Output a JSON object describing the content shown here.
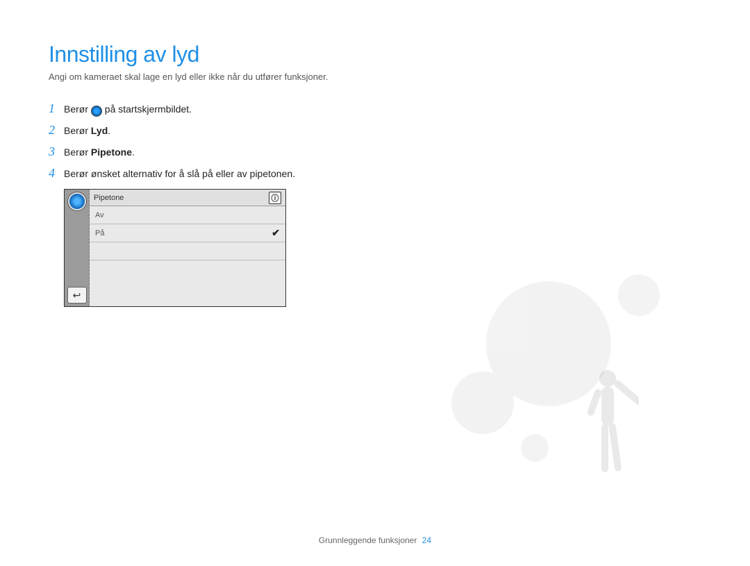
{
  "title": "Innstilling av lyd",
  "subtitle": "Angi om kameraet skal lage en lyd eller ikke når du utfører funksjoner.",
  "steps": [
    {
      "num": "1",
      "pre": "Berør ",
      "icon": "gear-icon",
      "post": " på startskjermbildet."
    },
    {
      "num": "2",
      "pre": "Berør ",
      "bold": "Lyd",
      "post": "."
    },
    {
      "num": "3",
      "pre": "Berør ",
      "bold": "Pipetone",
      "post": "."
    },
    {
      "num": "4",
      "pre": "Berør ønsket alternativ for å slå på eller av pipetonen.",
      "post": ""
    }
  ],
  "device": {
    "header": "Pipetone",
    "options": [
      {
        "label": "Av",
        "selected": false
      },
      {
        "label": "På",
        "selected": true
      }
    ]
  },
  "footer": {
    "section": "Grunnleggende funksjoner",
    "page": "24"
  }
}
